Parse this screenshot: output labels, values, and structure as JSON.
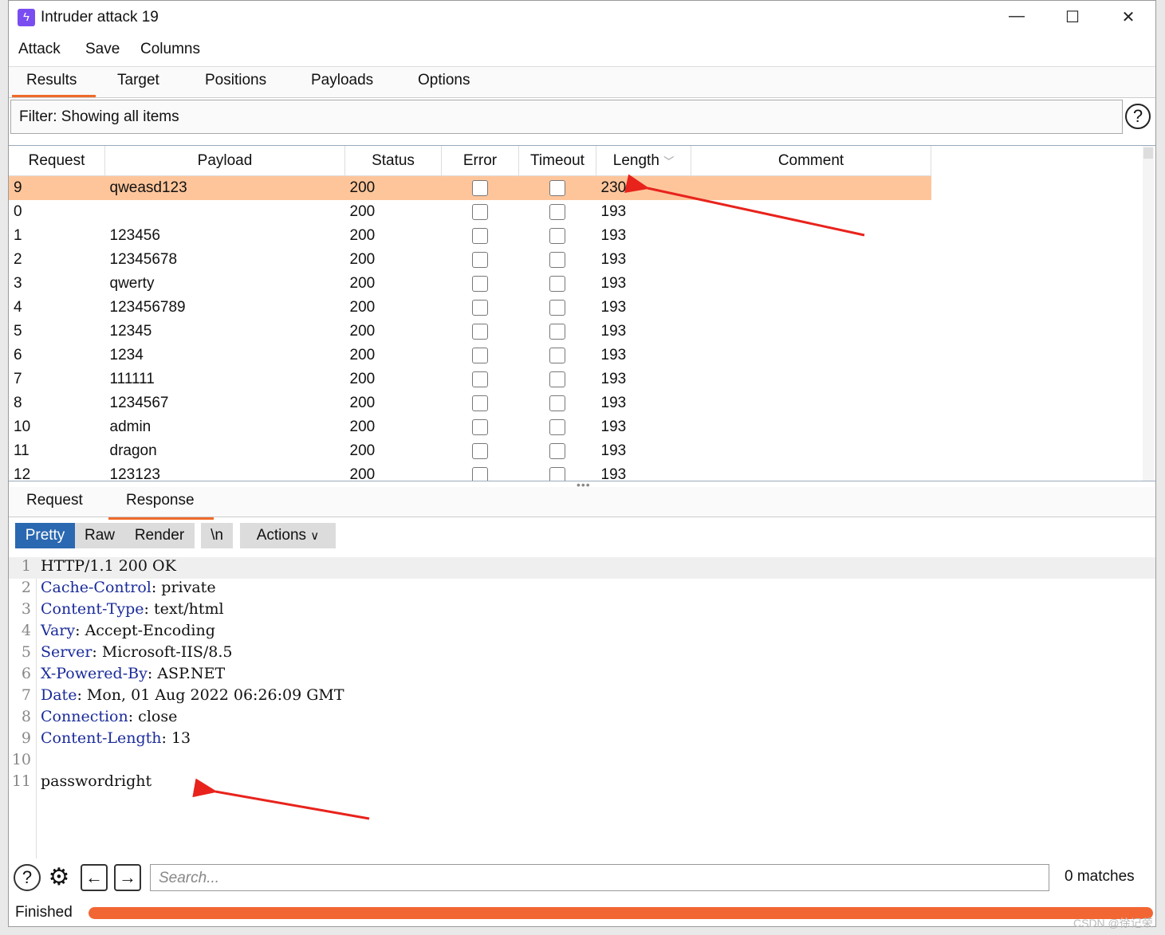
{
  "window": {
    "title": "Intruder attack 19"
  },
  "menu": [
    "Attack",
    "Save",
    "Columns"
  ],
  "tabs": [
    "Results",
    "Target",
    "Positions",
    "Payloads",
    "Options"
  ],
  "filter": {
    "text": "Filter: Showing all items",
    "help": "?"
  },
  "table": {
    "columns": [
      "Request",
      "Payload",
      "Status",
      "Error",
      "Timeout",
      "Length",
      "Comment"
    ],
    "sort_icon": "chevron-down-icon",
    "rows": [
      {
        "request": "9",
        "payload": "qweasd123",
        "status": "200",
        "length": "230",
        "selected": true
      },
      {
        "request": "0",
        "payload": "",
        "status": "200",
        "length": "193"
      },
      {
        "request": "1",
        "payload": "123456",
        "status": "200",
        "length": "193"
      },
      {
        "request": "2",
        "payload": "12345678",
        "status": "200",
        "length": "193"
      },
      {
        "request": "3",
        "payload": "qwerty",
        "status": "200",
        "length": "193"
      },
      {
        "request": "4",
        "payload": "123456789",
        "status": "200",
        "length": "193"
      },
      {
        "request": "5",
        "payload": "12345",
        "status": "200",
        "length": "193"
      },
      {
        "request": "6",
        "payload": "1234",
        "status": "200",
        "length": "193"
      },
      {
        "request": "7",
        "payload": "111111",
        "status": "200",
        "length": "193"
      },
      {
        "request": "8",
        "payload": "1234567",
        "status": "200",
        "length": "193"
      },
      {
        "request": "10",
        "payload": "admin",
        "status": "200",
        "length": "193"
      },
      {
        "request": "11",
        "payload": "dragon",
        "status": "200",
        "length": "193"
      },
      {
        "request": "12",
        "payload": "123123",
        "status": "200",
        "length": "193"
      }
    ]
  },
  "subtabs": [
    "Request",
    "Response"
  ],
  "view_buttons": {
    "pretty": "Pretty",
    "raw": "Raw",
    "render": "Render",
    "newline": "\\n",
    "actions": "Actions"
  },
  "response_lines": [
    {
      "key": "",
      "value": "HTTP/1.1 200 OK"
    },
    {
      "key": "Cache-Control",
      "value": ": private"
    },
    {
      "key": "Content-Type",
      "value": ": text/html"
    },
    {
      "key": "Vary",
      "value": ": Accept-Encoding"
    },
    {
      "key": "Server",
      "value": ": Microsoft-IIS/8.5"
    },
    {
      "key": "X-Powered-By",
      "value": ": ASP.NET"
    },
    {
      "key": "Date",
      "value": ": Mon, 01 Aug 2022 06:26:09 GMT"
    },
    {
      "key": "Connection",
      "value": ": close"
    },
    {
      "key": "Content-Length",
      "value": ": 13"
    },
    {
      "key": "",
      "value": ""
    },
    {
      "key": "",
      "value": "passwordright"
    }
  ],
  "search": {
    "placeholder": "Search...",
    "matches": "0 matches"
  },
  "status": {
    "text": "Finished",
    "progress": 1.0
  },
  "watermark": "CSDN @徐记荣",
  "colors": {
    "accent": "#f26633",
    "selected_row": "#fec59b",
    "pretty_button": "#2a68b1",
    "arrow": "#e8231c"
  }
}
